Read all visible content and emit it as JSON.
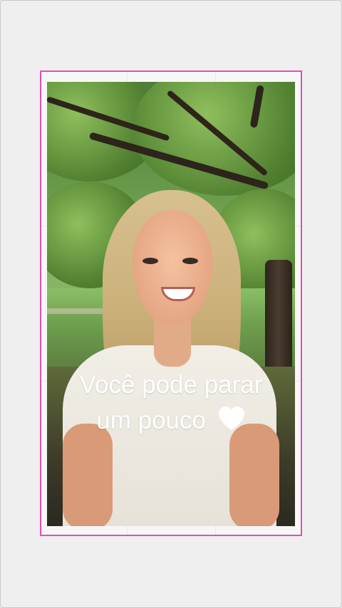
{
  "story": {
    "caption_line1": "Você pode parar",
    "caption_line2": "um pouco",
    "emoji": "heart-icon"
  },
  "colors": {
    "frame_border": "#e24fb4",
    "caption_text": "#ffffff"
  }
}
